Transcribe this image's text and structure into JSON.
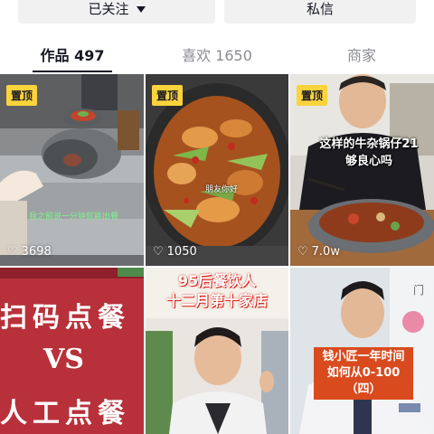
{
  "buttons": {
    "follow_label": "已关注",
    "message_label": "私信"
  },
  "tabs": [
    {
      "label": "作品 497"
    },
    {
      "label": "喜欢 1650"
    },
    {
      "label": "商家"
    }
  ],
  "videos": [
    {
      "pinned": "置顶",
      "likes": "3698",
      "caption": "我之前说一分钟就能出餐"
    },
    {
      "pinned": "置顶",
      "likes": "1050",
      "caption": "朋友你好"
    },
    {
      "pinned": "置顶",
      "likes": "7.0w",
      "title_line1": "这样的牛杂锅仔21",
      "title_line2": "够良心吗"
    },
    {
      "line1": "扫码点餐",
      "vs": "VS",
      "line2": "人工点餐"
    },
    {
      "title_line1": "95后餐饮人",
      "title_line2": "十二月第十家店"
    },
    {
      "title_line1": "钱小匠一年时间",
      "title_line2": "如何从0-100（四）",
      "side": "门"
    }
  ],
  "colors": {
    "pin_bg": "#fbd33b",
    "red_panel": "#b8313a",
    "orange_banner": "#d94b1f"
  }
}
